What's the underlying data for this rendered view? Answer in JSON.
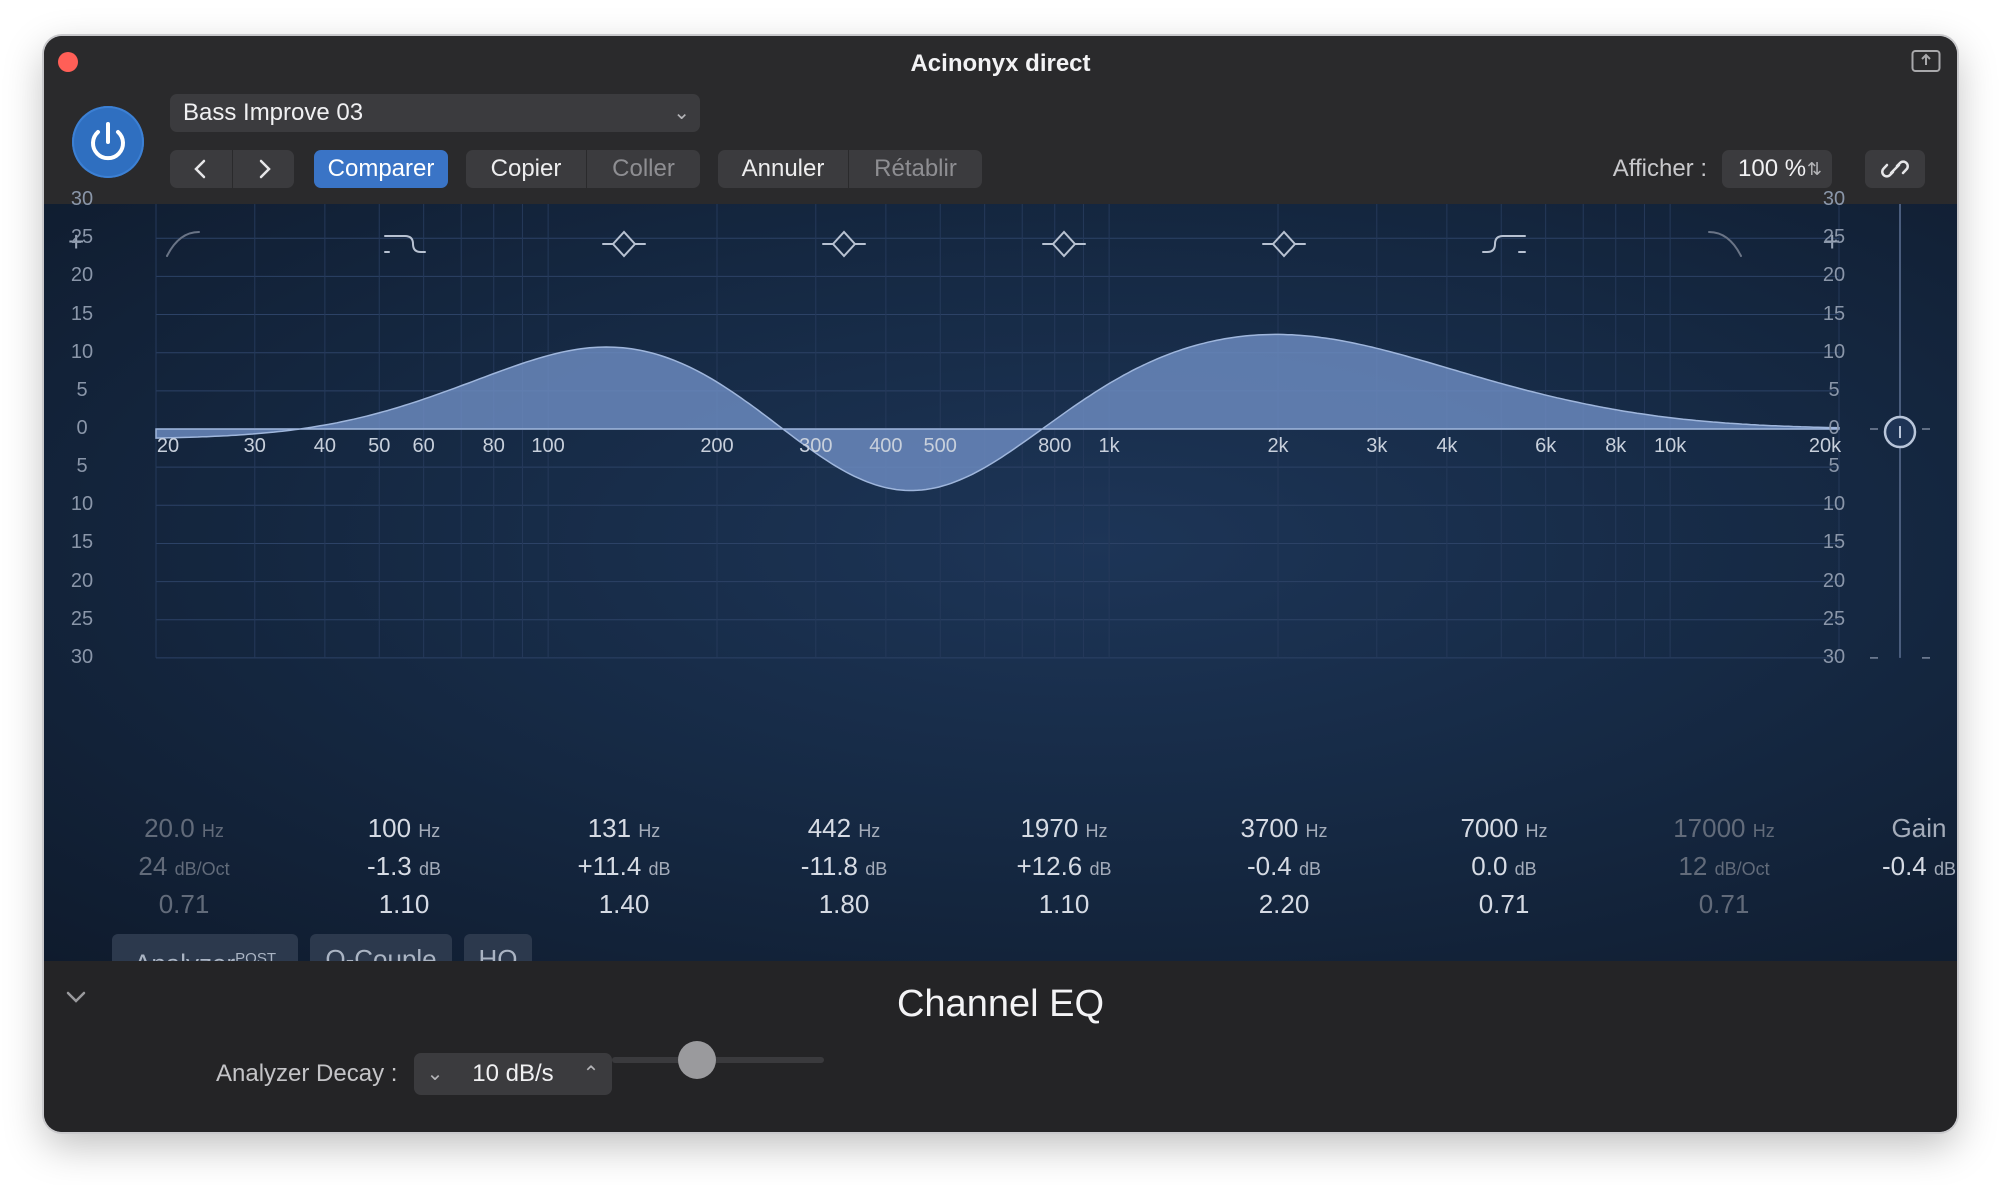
{
  "window": {
    "title": "Acinonyx direct"
  },
  "header": {
    "preset": "Bass Improve 03",
    "compare": "Comparer",
    "copy": "Copier",
    "paste": "Coller",
    "undo": "Annuler",
    "redo": "Rétablir",
    "view_label": "Afficher :",
    "zoom": "100 %"
  },
  "graph": {
    "db_left": [
      "30",
      "25",
      "20",
      "15",
      "10",
      "5",
      "0",
      "5",
      "10",
      "15",
      "20",
      "25",
      "30"
    ],
    "db_right": [
      "30",
      "25",
      "20",
      "15",
      "10",
      "5",
      "0",
      "5",
      "10",
      "15",
      "20",
      "25",
      "30"
    ],
    "freq_labels": [
      "20",
      "30",
      "40",
      "50",
      "60",
      "80",
      "100",
      "200",
      "300",
      "400",
      "500",
      "800",
      "1k",
      "2k",
      "3k",
      "4k",
      "6k",
      "8k",
      "10k",
      "20k"
    ],
    "curve_color": "#6f8fc4",
    "accent_color": "#3a74c6"
  },
  "bands": [
    {
      "type": "high-pass-icon",
      "enabled": false,
      "freq": "20.0",
      "freq_unit": "Hz",
      "second": "24",
      "second_unit": "dB/Oct",
      "q": "0.71"
    },
    {
      "type": "low-shelf-icon",
      "enabled": true,
      "freq": "100",
      "freq_unit": "Hz",
      "second": "-1.3",
      "second_unit": "dB",
      "q": "1.10"
    },
    {
      "type": "bell-icon",
      "enabled": true,
      "freq": "131",
      "freq_unit": "Hz",
      "second": "+11.4",
      "second_unit": "dB",
      "q": "1.40"
    },
    {
      "type": "bell-icon",
      "enabled": true,
      "freq": "442",
      "freq_unit": "Hz",
      "second": "-11.8",
      "second_unit": "dB",
      "q": "1.80"
    },
    {
      "type": "bell-icon",
      "enabled": true,
      "freq": "1970",
      "freq_unit": "Hz",
      "second": "+12.6",
      "second_unit": "dB",
      "q": "1.10"
    },
    {
      "type": "bell-icon",
      "enabled": true,
      "freq": "3700",
      "freq_unit": "Hz",
      "second": "-0.4",
      "second_unit": "dB",
      "q": "2.20"
    },
    {
      "type": "high-shelf-icon",
      "enabled": true,
      "freq": "7000",
      "freq_unit": "Hz",
      "second": "0.0",
      "second_unit": "dB",
      "q": "0.71"
    },
    {
      "type": "low-pass-icon",
      "enabled": false,
      "freq": "17000",
      "freq_unit": "Hz",
      "second": "12",
      "second_unit": "dB/Oct",
      "q": "0.71"
    }
  ],
  "gain": {
    "label": "Gain",
    "value": "-0.4",
    "unit": "dB",
    "level_db": -0.4
  },
  "toggles": {
    "analyzer": "Analyzer",
    "analyzer_sup": "POST",
    "q_couple": "Q-Couple",
    "hq": "HQ"
  },
  "footer": {
    "plugin_name": "Channel EQ",
    "decay_label": "Analyzer Decay :",
    "decay_value": "10 dB/s",
    "decay_slider_fraction": 0.4
  }
}
